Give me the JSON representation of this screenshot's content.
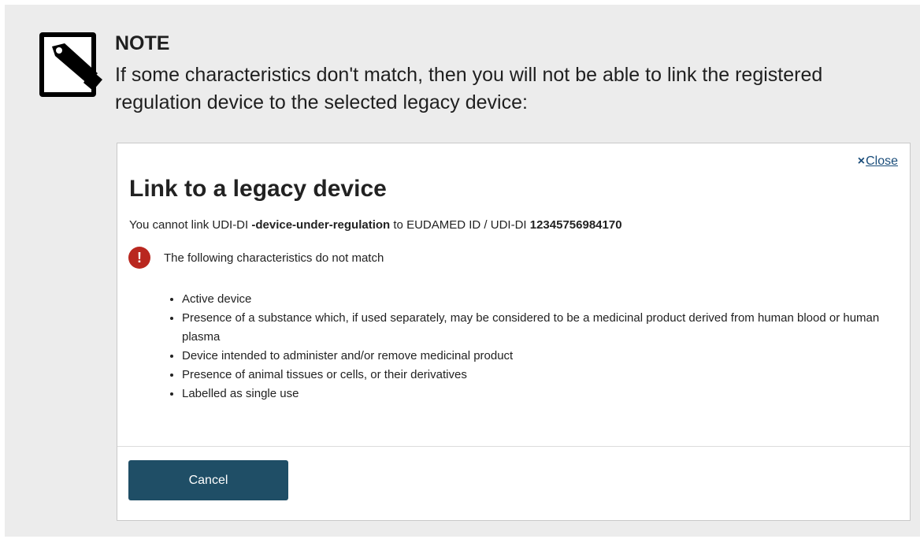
{
  "note": {
    "title": "NOTE",
    "text": "If some characteristics don't match, then you will not be able to link the registered regulation device to the selected legacy device:",
    "icon": "pencil-icon"
  },
  "dialog": {
    "close_symbol": "×",
    "close_label": "Close",
    "title": "Link to a legacy device",
    "message_prefix": "You cannot link UDI-DI ",
    "device_id": "-device-under-regulation",
    "message_middle": " to EUDAMED ID / UDI-DI ",
    "eudamed_id": "12345756984170",
    "error_icon": "exclamation-icon",
    "error_icon_glyph": "!",
    "error_color": "#b9271f",
    "error_text": "The following characteristics do not match",
    "characteristics": [
      "Active device",
      "Presence of a substance which, if used separately, may be considered to be a medicinal product derived from human blood or human plasma",
      "Device intended to administer and/or remove medicinal product",
      "Presence of animal tissues or cells, or their derivatives",
      "Labelled as single use"
    ],
    "cancel_label": "Cancel",
    "button_color": "#1f4e66"
  }
}
